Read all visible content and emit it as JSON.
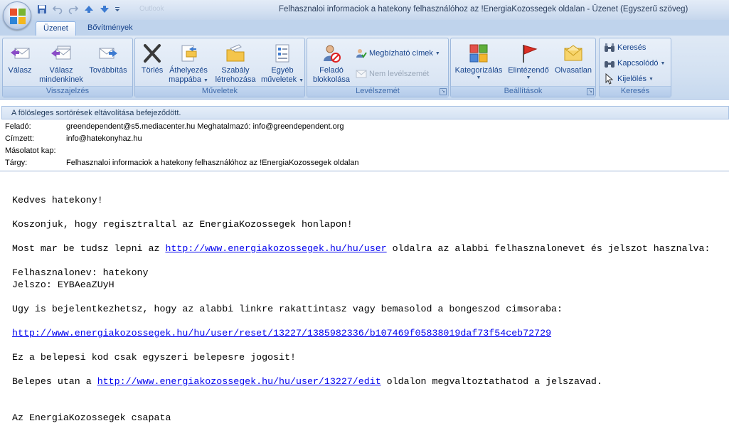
{
  "window": {
    "title": "Felhasznaloi informaciok a hatekony felhasználóhoz az !EnergiaKozossegek oldalan - Üzenet (Egyszerű szöveg)",
    "ghost_title": "Outlook"
  },
  "tabs": [
    {
      "label": "Üzenet",
      "active": true
    },
    {
      "label": "Bővítmények",
      "active": false
    }
  ],
  "ribbon": {
    "groups": {
      "respond": {
        "label": "Visszajelzés",
        "reply": "Válasz",
        "reply_all_1": "Válasz",
        "reply_all_2": "mindenkinek",
        "forward": "Továbbítás"
      },
      "actions": {
        "label": "Műveletek",
        "delete": "Törlés",
        "move_1": "Áthelyezés",
        "move_2": "mappába",
        "rule_1": "Szabály",
        "rule_2": "létrehozása",
        "other_1": "Egyéb",
        "other_2": "műveletek"
      },
      "junk": {
        "label": "Levélszemét",
        "block_1": "Feladó",
        "block_2": "blokkolása",
        "safe_lists": "Megbízható címek",
        "not_junk": "Nem levélszemét"
      },
      "options": {
        "label": "Beállítások",
        "categorize": "Kategorizálás",
        "follow_up": "Elintézendő",
        "mark_unread": "Olvasatlan"
      },
      "find": {
        "label": "Keresés",
        "find": "Keresés",
        "related": "Kapcsolódó",
        "select": "Kijelölés"
      }
    }
  },
  "infobar": {
    "text": "A fölösleges sortörések eltávolítása befejeződött."
  },
  "headers": {
    "from_label": "Feladó:",
    "from_value": "greendependent@s5.mediacenter.hu Meghatalmazó: info@greendependent.org",
    "to_label": "Címzett:",
    "to_value": "info@hatekonyhaz.hu",
    "cc_label": "Másolatot kap:",
    "cc_value": "",
    "subject_label": "Tárgy:",
    "subject_value": "Felhasznaloi informaciok a hatekony felhasználóhoz az !EnergiaKozossegek oldalan"
  },
  "body": {
    "greeting": "Kedves hatekony!",
    "thanks": "Koszonjuk, hogy regisztraltal az EnergiaKozossegek honlapon!",
    "login_pre": "Most mar be tudsz lepni az ",
    "login_link": "http://www.energiakozossegek.hu/hu/user",
    "login_post": " oldalra az alabbi felhasznalonevet és jelszot hasznalva:",
    "username_line": "Felhasznalonev: hatekony",
    "password_line": "Jelszo: EYBAeaZUyH",
    "reset_intro": "Ugy is bejelentkezhetsz, hogy az alabbi linkre rakattintasz vagy bemasolod a bongeszod cimsoraba:",
    "reset_link": "http://www.energiakozossegek.hu/hu/user/reset/13227/1385982336/b107469f05838019daf73f54ceb72729",
    "one_time": "Ez a belepesi kod csak egyszeri belepesre jogosit!",
    "edit_pre": "Belepes utan a ",
    "edit_link": "http://www.energiakozossegek.hu/hu/user/13227/edit",
    "edit_post": " oldalon megvaltoztathatod a jelszavad.",
    "signature": "Az EnergiaKozossegek csapata"
  }
}
